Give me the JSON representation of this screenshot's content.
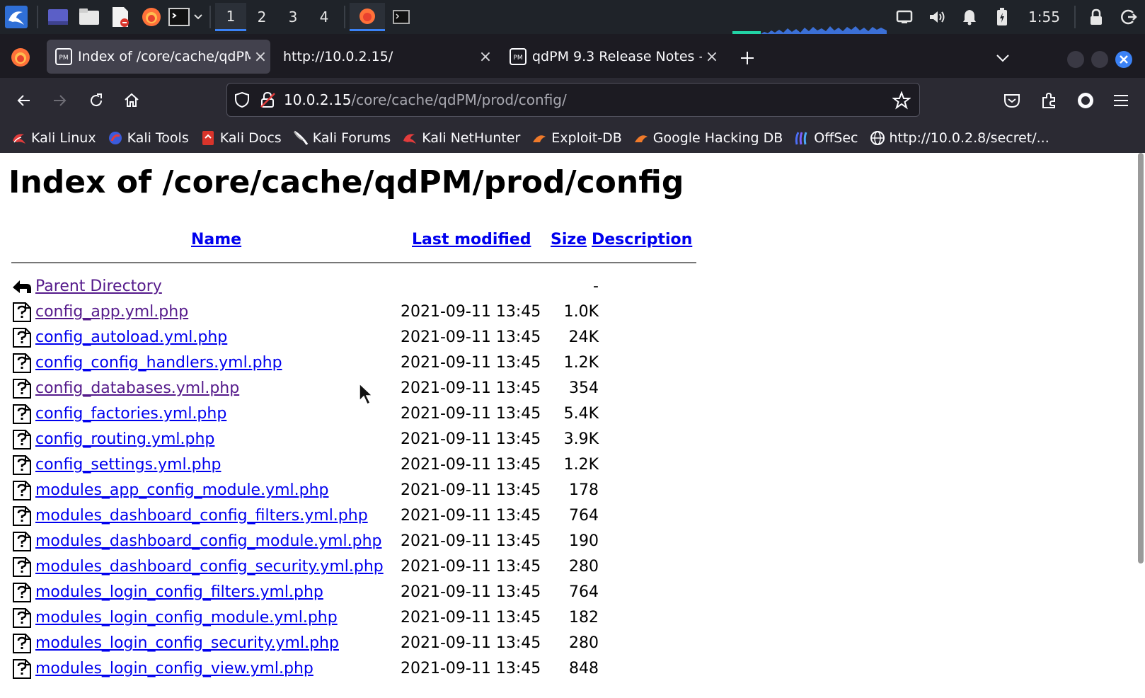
{
  "taskbar": {
    "workspaces": [
      "1",
      "2",
      "3",
      "4"
    ],
    "active_workspace": 0,
    "clock": "1:55"
  },
  "tabs": [
    {
      "label": "Index of /core/cache/qdPM",
      "active": true
    },
    {
      "label": "http://10.0.2.15/",
      "active": false
    },
    {
      "label": "qdPM 9.3 Release Notes -",
      "active": false
    }
  ],
  "urlbar": {
    "host": "10.0.2.15",
    "path": "/core/cache/qdPM/prod/config/"
  },
  "bookmarks": [
    {
      "label": "Kali Linux",
      "icon": "kali-dragon-icon"
    },
    {
      "label": "Kali Tools",
      "icon": "kali-tools-icon"
    },
    {
      "label": "Kali Docs",
      "icon": "kali-docs-icon"
    },
    {
      "label": "Kali Forums",
      "icon": "kali-forums-icon"
    },
    {
      "label": "Kali NetHunter",
      "icon": "kali-nethunter-icon"
    },
    {
      "label": "Exploit-DB",
      "icon": "exploit-db-icon"
    },
    {
      "label": "Google Hacking DB",
      "icon": "ghdb-icon"
    },
    {
      "label": "OffSec",
      "icon": "offsec-icon"
    },
    {
      "label": "http://10.0.2.8/secret/...",
      "icon": "globe-icon"
    }
  ],
  "page": {
    "title": "Index of /core/cache/qdPM/prod/config",
    "headers": {
      "name": "Name",
      "modified": "Last modified",
      "size": "Size",
      "description": "Description"
    },
    "parent": {
      "name": "Parent Directory",
      "size": "-"
    },
    "files": [
      {
        "name": "config_app.yml.php",
        "date": "2021-09-11 13:45",
        "size": "1.0K",
        "visited": true
      },
      {
        "name": "config_autoload.yml.php",
        "date": "2021-09-11 13:45",
        "size": "24K",
        "visited": false
      },
      {
        "name": "config_config_handlers.yml.php",
        "date": "2021-09-11 13:45",
        "size": "1.2K",
        "visited": false
      },
      {
        "name": "config_databases.yml.php",
        "date": "2021-09-11 13:45",
        "size": "354",
        "visited": true
      },
      {
        "name": "config_factories.yml.php",
        "date": "2021-09-11 13:45",
        "size": "5.4K",
        "visited": false
      },
      {
        "name": "config_routing.yml.php",
        "date": "2021-09-11 13:45",
        "size": "3.9K",
        "visited": false
      },
      {
        "name": "config_settings.yml.php",
        "date": "2021-09-11 13:45",
        "size": "1.2K",
        "visited": false
      },
      {
        "name": "modules_app_config_module.yml.php",
        "date": "2021-09-11 13:45",
        "size": "178",
        "visited": false
      },
      {
        "name": "modules_dashboard_config_filters.yml.php",
        "date": "2021-09-11 13:45",
        "size": "764",
        "visited": false
      },
      {
        "name": "modules_dashboard_config_module.yml.php",
        "date": "2021-09-11 13:45",
        "size": "190",
        "visited": false
      },
      {
        "name": "modules_dashboard_config_security.yml.php",
        "date": "2021-09-11 13:45",
        "size": "280",
        "visited": false
      },
      {
        "name": "modules_login_config_filters.yml.php",
        "date": "2021-09-11 13:45",
        "size": "764",
        "visited": false
      },
      {
        "name": "modules_login_config_module.yml.php",
        "date": "2021-09-11 13:45",
        "size": "182",
        "visited": false
      },
      {
        "name": "modules_login_config_security.yml.php",
        "date": "2021-09-11 13:45",
        "size": "280",
        "visited": false
      },
      {
        "name": "modules_login_config_view.yml.php",
        "date": "2021-09-11 13:45",
        "size": "848",
        "visited": false
      }
    ]
  },
  "colors": {
    "link": "#0000ee",
    "visited": "#551a8b",
    "accent": "#3b82f6"
  }
}
